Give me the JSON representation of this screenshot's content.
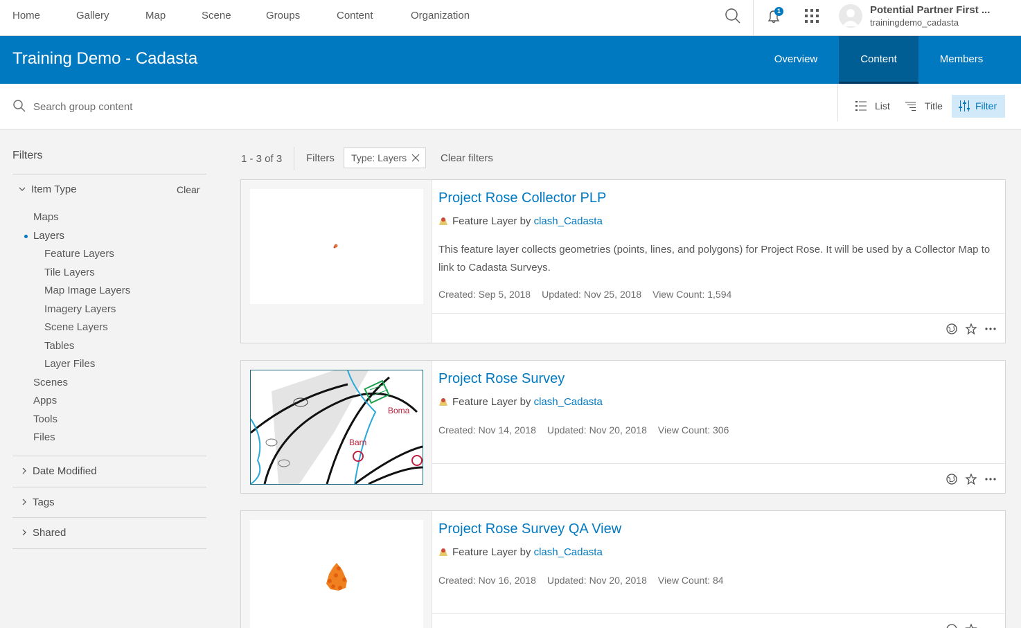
{
  "topnav": {
    "items": [
      "Home",
      "Gallery",
      "Map",
      "Scene",
      "Groups",
      "Content",
      "Organization"
    ],
    "notification_count": "1",
    "user_name": "Potential Partner First ...",
    "user_id": "trainingdemo_cadasta"
  },
  "header": {
    "title": "Training Demo - Cadasta",
    "tabs": [
      "Overview",
      "Content",
      "Members"
    ],
    "active_tab": "Content"
  },
  "search": {
    "placeholder": "Search group content",
    "buttons": [
      "List",
      "Title",
      "Filter"
    ]
  },
  "sidebar": {
    "title": "Filters",
    "item_type": {
      "label": "Item Type",
      "clear": "Clear",
      "items": [
        "Maps",
        "Layers"
      ],
      "sub_items": [
        "Feature Layers",
        "Tile Layers",
        "Map Image Layers",
        "Imagery Layers",
        "Scene Layers",
        "Tables",
        "Layer Files"
      ],
      "more_items": [
        "Scenes",
        "Apps",
        "Tools",
        "Files"
      ],
      "selected": "Layers"
    },
    "sections": [
      "Date Modified",
      "Tags",
      "Shared"
    ]
  },
  "results": {
    "count": "1 - 3 of 3",
    "filters_label": "Filters",
    "chip": "Type: Layers",
    "clear_filters": "Clear filters"
  },
  "cards": [
    {
      "title": "Project Rose Collector PLP",
      "type": "Feature Layer",
      "by": "by",
      "owner": "clash_Cadasta",
      "description": "This feature layer collects geometries (points, lines, and polygons) for Project Rose. It will be used by a Collector Map to link to Cadasta Surveys.",
      "created": "Created: Sep 5, 2018",
      "updated": "Updated: Nov 25, 2018",
      "views": "View Count: 1,594"
    },
    {
      "title": "Project Rose Survey",
      "type": "Feature Layer",
      "by": "by",
      "owner": "clash_Cadasta",
      "description": "",
      "created": "Created: Nov 14, 2018",
      "updated": "Updated: Nov 20, 2018",
      "views": "View Count: 306"
    },
    {
      "title": "Project Rose Survey QA View",
      "type": "Feature Layer",
      "by": "by",
      "owner": "clash_Cadasta",
      "description": "",
      "created": "Created: Nov 16, 2018",
      "updated": "Updated: Nov 20, 2018",
      "views": "View Count: 84"
    }
  ],
  "colors": {
    "brand_blue": "#0079c1",
    "active_tab": "#005e95",
    "filter_active_bg": "#d2e9f9"
  }
}
